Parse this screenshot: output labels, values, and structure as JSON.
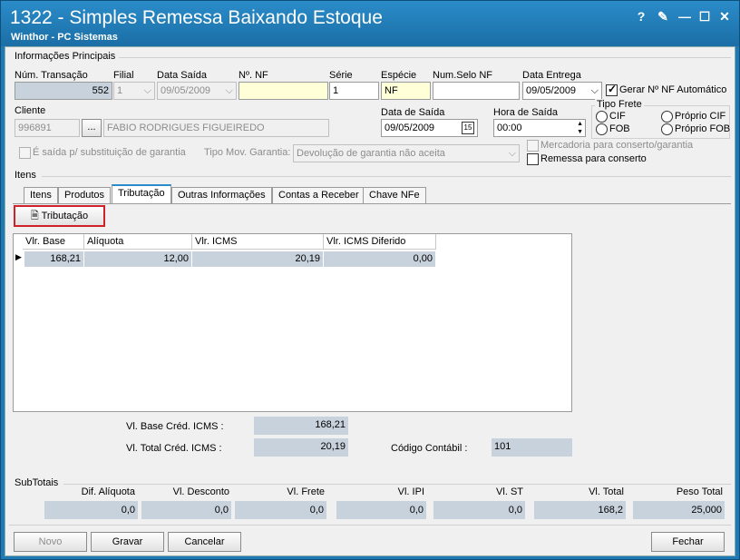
{
  "window": {
    "title": "1322 - Simples Remessa Baixando Estoque",
    "subtitle": "Winthor - PC Sistemas",
    "controls": [
      "?",
      "✎",
      "—",
      "☐",
      "✕"
    ]
  },
  "principais": {
    "group_label": "Informações Principais",
    "num_transacao_label": "Núm. Transação",
    "num_transacao": "552",
    "filial_label": "Filial",
    "filial": "1",
    "data_saida_label": "Data Saída",
    "data_saida": "09/05/2009",
    "num_nf_label": "Nº. NF",
    "num_nf": "",
    "serie_label": "Série",
    "serie": "1",
    "especie_label": "Espécie",
    "especie": "NF",
    "num_selo_label": "Num.Selo NF",
    "num_selo": "",
    "data_entrega_label": "Data Entrega",
    "data_entrega": "09/05/2009",
    "gerar_nf_label": "Gerar Nº NF Automático",
    "cliente_label": "Cliente",
    "cliente_codigo": "996891",
    "cliente_btn": "...",
    "cliente_nome": "FABIO RODRIGUES FIGUEIREDO",
    "data_de_saida_label": "Data de Saída",
    "data_de_saida": "09/05/2009",
    "hora_saida_label": "Hora de Saída",
    "hora_saida": "00:00",
    "tipo_frete_label": "Tipo Frete",
    "frete_cif": "CIF",
    "frete_proprio_cif": "Próprio CIF",
    "frete_fob": "FOB",
    "frete_proprio_fob": "Próprio FOB",
    "substituicao_label": "É saída p/ substituição de garantia",
    "tipo_mov_label": "Tipo Mov. Garantia:",
    "tipo_mov": "Devolução de garantia não aceita",
    "mercadoria_conserto_label": "Mercadoria para conserto/garantia",
    "remessa_conserto_label": "Remessa para conserto"
  },
  "itens": {
    "group_label": "Itens",
    "tabs": [
      "Itens",
      "Produtos",
      "Tributação",
      "Outras Informações",
      "Contas a Receber",
      "Chave NFe"
    ],
    "tributacao_btn": "Tributação",
    "grid_headers": [
      "Vlr. Base",
      "Alíquota",
      "Vlr. ICMS",
      "Vlr. ICMS Diferido"
    ],
    "grid_row": [
      "168,21",
      "12,00",
      "20,19",
      "0,00"
    ],
    "vl_base_cred_label": "Vl. Base Créd. ICMS :",
    "vl_base_cred": "168,21",
    "vl_total_cred_label": "Vl. Total Créd. ICMS :",
    "vl_total_cred": "20,19",
    "codigo_contabil_label": "Código Contábil :",
    "codigo_contabil": "101"
  },
  "subtotais": {
    "group_label": "SubTotais",
    "labels": [
      "Dif. Alíquota",
      "Vl. Desconto",
      "Vl. Frete",
      "Vl. IPI",
      "Vl. ST",
      "Vl. Total",
      "Peso Total"
    ],
    "values": [
      "0,0",
      "0,0",
      "0,0",
      "0,0",
      "0,0",
      "168,2",
      "25,000"
    ]
  },
  "footer": {
    "novo": "Novo",
    "gravar": "Gravar",
    "cancelar": "Cancelar",
    "fechar": "Fechar"
  }
}
